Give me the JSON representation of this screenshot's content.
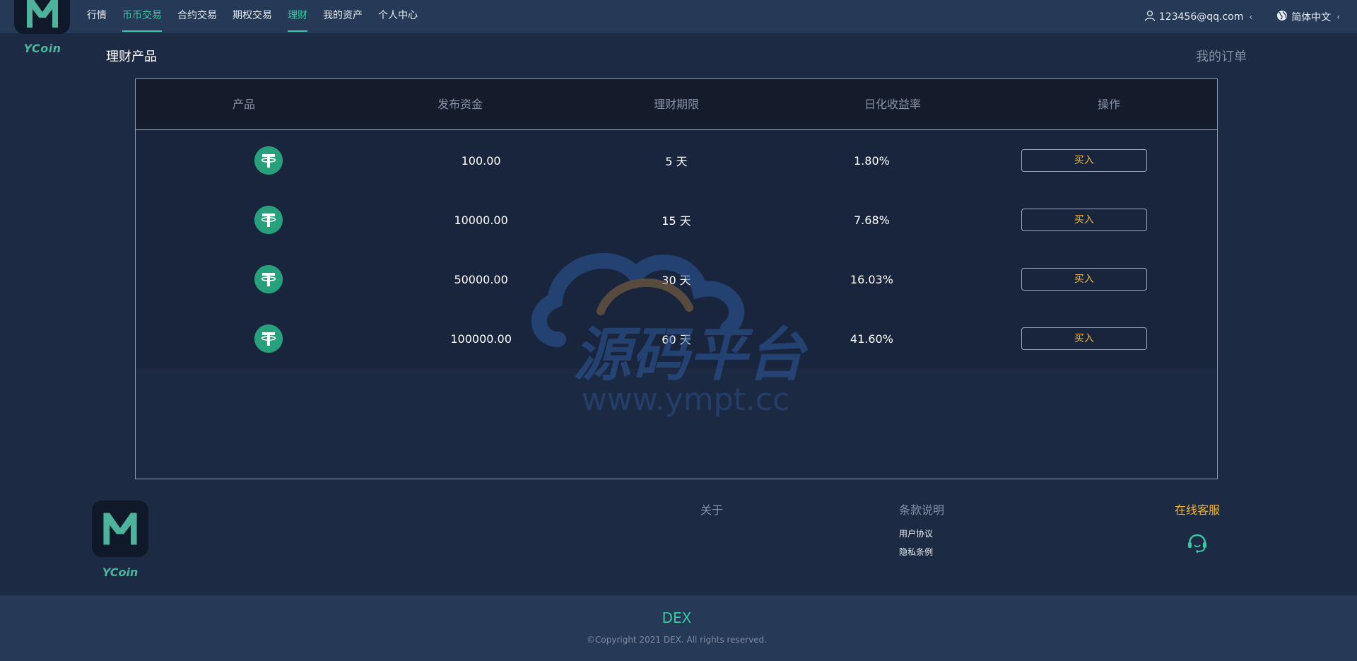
{
  "header": {
    "logo_text": "YCoin",
    "nav": [
      {
        "label": "行情",
        "active": false
      },
      {
        "label": "币币交易",
        "active": true
      },
      {
        "label": "合约交易",
        "active": false
      },
      {
        "label": "期权交易",
        "active": false
      },
      {
        "label": "理财",
        "active": true
      },
      {
        "label": "我的资产",
        "active": false
      },
      {
        "label": "个人中心",
        "active": false
      }
    ],
    "user_email": "123456@qq.com",
    "language": "简体中文"
  },
  "page": {
    "title": "理财产品",
    "my_orders": "我的订单"
  },
  "table": {
    "columns": [
      "产品",
      "发布资金",
      "理财期限",
      "日化收益率",
      "操作"
    ],
    "rows": [
      {
        "amount": "100.00",
        "term": "5 天",
        "rate": "1.80%",
        "action": "买入"
      },
      {
        "amount": "10000.00",
        "term": "15 天",
        "rate": "7.68%",
        "action": "买入"
      },
      {
        "amount": "50000.00",
        "term": "30 天",
        "rate": "16.03%",
        "action": "买入"
      },
      {
        "amount": "100000.00",
        "term": "60 天",
        "rate": "41.60%",
        "action": "买入"
      }
    ]
  },
  "watermark": {
    "title": "源码平台",
    "url": "www.ympt.cc"
  },
  "footer": {
    "logo_text": "YCoin",
    "about_title": "关于",
    "terms_title": "条款说明",
    "terms_links": [
      "用户协议",
      "隐私条例"
    ],
    "service_title": "在线客服",
    "brand": "DEX",
    "copyright": "©Copyright 2021 DEX. All rights reserved."
  },
  "colors": {
    "accent": "#3cc7a2",
    "buy": "#e7b64a",
    "service": "#f0b429",
    "tether": "#26a17b"
  }
}
